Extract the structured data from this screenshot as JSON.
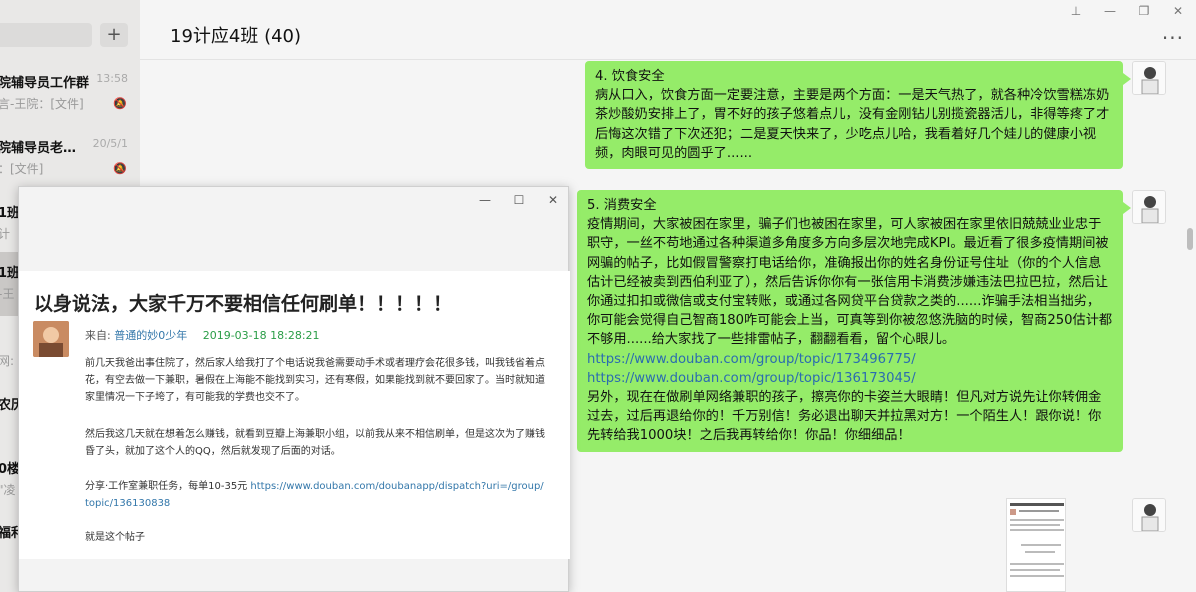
{
  "chat_list": {
    "plus_label": "+",
    "items": [
      {
        "name": "院辅导员工作群",
        "time": "13:58",
        "sub": "言-王院：[文件]"
      },
      {
        "name": "院辅导员老…",
        "time": "20/5/1",
        "sub": "：[文件]"
      },
      {
        "name": "1班",
        "time": "",
        "sub": "计"
      },
      {
        "name": "1班",
        "time": "",
        "sub": "-王"
      },
      {
        "name": "",
        "time": "",
        "sub": "网:"
      },
      {
        "name": "农历",
        "time": "",
        "sub": ""
      },
      {
        "name": "0楼",
        "time": "",
        "sub": "\"凌"
      },
      {
        "name": "福利",
        "time": "",
        "sub": ""
      }
    ]
  },
  "header": {
    "title": "19计应4班 (40)",
    "more_label": "···",
    "win_pin": "⊥",
    "win_min": "—",
    "win_max": "❐",
    "win_close": "✕"
  },
  "messages": {
    "msg1": {
      "heading": "4. 饮食安全",
      "body": "病从口入，饮食方面一定要注意，主要是两个方面：一是天气热了，就各种冷饮雪糕冻奶茶炒酸奶安排上了，胃不好的孩子悠着点儿，没有金刚钻儿别揽瓷器活儿，非得等疼了才后悔这次错了下次还犯；二是夏天快来了，少吃点儿哈，我看着好几个娃儿的健康小视频，肉眼可见的圆乎了......"
    },
    "msg2": {
      "heading": "5. 消费安全",
      "body": "疫情期间，大家被困在家里，骗子们也被困在家里，可人家被困在家里依旧兢兢业业忠于职守，一丝不苟地通过各种渠道多角度多方向多层次地完成KPI。最近看了很多疫情期间被网骗的帖子，比如假冒警察打电话给你，准确报出你的姓名身份证号住址（你的个人信息估计已经被卖到西伯利亚了），然后告诉你你有一张信用卡消费涉嫌违法巴拉巴拉，然后让你通过扣扣或微信或支付宝转账，或通过各网贷平台贷款之类的......诈骗手法相当拙劣，你可能会觉得自己智商180咋可能会上当，可真等到你被忽悠洗脑的时候，智商250估计都不够用......给大家找了一些排雷帖子，翻翻看看，留个心眼儿。",
      "link1": "https://www.douban.com/group/topic/173496775/",
      "link2": "https://www.douban.com/group/topic/136173045/",
      "tail": "另外，现在在做刷单网络兼职的孩子，擦亮你的卡姿兰大眼睛！但凡对方说先让你转佣金过去，过后再退给你的！千万别信！务必退出聊天并拉黑对方！一个陌生人！跟你说！你先转给我1000块！之后我再转给你！你品！你细细品！"
    }
  },
  "popup": {
    "win_min": "—",
    "win_max": "☐",
    "win_close": "✕",
    "post_title": "以身说法，大家千万不要相信任何刷单！！！！！",
    "from_label": "来自:",
    "author": "普通的妙0少年",
    "date": "2019-03-18 18:28:21",
    "para1": "前几天我爸出事住院了，然后家人给我打了个电话说我爸需要动手术或者理疗会花很多钱，叫我钱省着点花，有空去做一下兼职，暑假在上海能不能找到实习，还有寒假，如果能找到就不要回家了。当时就知道家里情况一下子垮了，有可能我的学费也交不了。",
    "para2": "然后我这几天就在想着怎么赚钱，就看到豆瓣上海兼职小组，以前我从来不相信刷单，但是这次为了赚钱昏了头，就加了这个人的QQ，然后就发现了后面的对话。",
    "para3_prefix": "分享·工作室兼职任务，每单10-35元 ",
    "para3_link": "https://www.douban.com/doubanapp/dispatch?uri=/group/topic/136130838",
    "para4": "就是这个帖子"
  }
}
